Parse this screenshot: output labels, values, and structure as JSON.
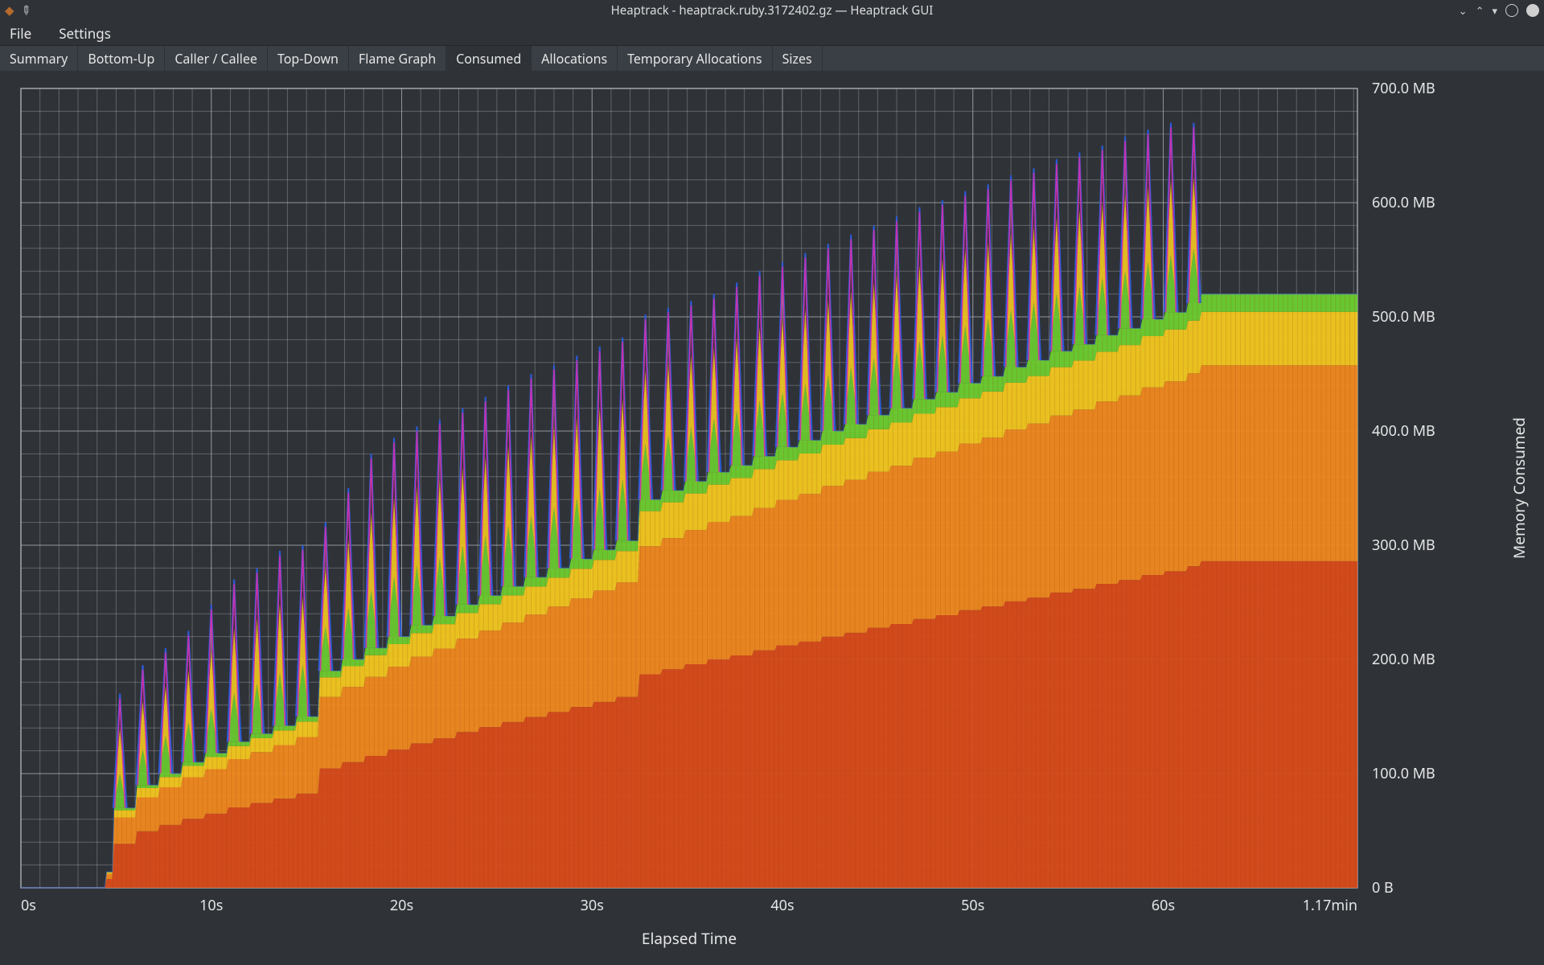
{
  "window": {
    "title": "Heaptrack - heaptrack.ruby.3172402.gz — Heaptrack GUI"
  },
  "menu": {
    "file": "File",
    "settings": "Settings"
  },
  "tabs": [
    {
      "id": "summary",
      "label": "Summary",
      "active": false
    },
    {
      "id": "bottomup",
      "label": "Bottom-Up",
      "active": false
    },
    {
      "id": "callercallee",
      "label": "Caller / Callee",
      "active": false
    },
    {
      "id": "topdown",
      "label": "Top-Down",
      "active": false
    },
    {
      "id": "flame",
      "label": "Flame Graph",
      "active": false
    },
    {
      "id": "consumed",
      "label": "Consumed",
      "active": true
    },
    {
      "id": "allocations",
      "label": "Allocations",
      "active": false
    },
    {
      "id": "tempalloc",
      "label": "Temporary Allocations",
      "active": false
    },
    {
      "id": "sizes",
      "label": "Sizes",
      "active": false
    }
  ],
  "chart_data": {
    "type": "area",
    "title": "",
    "xlabel": "Elapsed Time",
    "ylabel": "Memory Consumed",
    "xlim_seconds": [
      0,
      70.2
    ],
    "ylim_mb": [
      0,
      700
    ],
    "x_tick_labels": [
      "0s",
      "10s",
      "20s",
      "30s",
      "40s",
      "50s",
      "60s",
      "1.17min"
    ],
    "x_tick_positions_s": [
      0,
      10,
      20,
      30,
      40,
      50,
      60,
      70.2
    ],
    "y_tick_labels": [
      "0 B",
      "100.0 MB",
      "200.0 MB",
      "300.0 MB",
      "400.0 MB",
      "500.0 MB",
      "600.0 MB",
      "700.0 MB"
    ],
    "y_tick_positions_mb": [
      0,
      100,
      200,
      300,
      400,
      500,
      600,
      700
    ],
    "x_minor_step_s": 1,
    "y_minor_step_mb": 20,
    "plateau_start_s": 62,
    "plateau_end_s": 70.2,
    "spikes": [
      {
        "t": 5.2,
        "base": 70,
        "peak": 170
      },
      {
        "t": 6.4,
        "base": 90,
        "peak": 195
      },
      {
        "t": 7.6,
        "base": 100,
        "peak": 210
      },
      {
        "t": 8.8,
        "base": 110,
        "peak": 225
      },
      {
        "t": 10.0,
        "base": 118,
        "peak": 248
      },
      {
        "t": 11.2,
        "base": 128,
        "peak": 270
      },
      {
        "t": 12.4,
        "base": 135,
        "peak": 280
      },
      {
        "t": 13.6,
        "base": 142,
        "peak": 295
      },
      {
        "t": 14.8,
        "base": 150,
        "peak": 300
      },
      {
        "t": 16.0,
        "base": 190,
        "peak": 320
      },
      {
        "t": 17.2,
        "base": 200,
        "peak": 350
      },
      {
        "t": 18.4,
        "base": 210,
        "peak": 380
      },
      {
        "t": 19.6,
        "base": 220,
        "peak": 394
      },
      {
        "t": 20.8,
        "base": 230,
        "peak": 404
      },
      {
        "t": 22.0,
        "base": 238,
        "peak": 410
      },
      {
        "t": 23.2,
        "base": 248,
        "peak": 420
      },
      {
        "t": 24.4,
        "base": 256,
        "peak": 430
      },
      {
        "t": 25.6,
        "base": 264,
        "peak": 440
      },
      {
        "t": 26.8,
        "base": 272,
        "peak": 450
      },
      {
        "t": 28.0,
        "base": 280,
        "peak": 458
      },
      {
        "t": 29.2,
        "base": 288,
        "peak": 466
      },
      {
        "t": 30.4,
        "base": 296,
        "peak": 474
      },
      {
        "t": 31.6,
        "base": 304,
        "peak": 482
      },
      {
        "t": 32.8,
        "base": 340,
        "peak": 502
      },
      {
        "t": 34.0,
        "base": 348,
        "peak": 508
      },
      {
        "t": 35.2,
        "base": 356,
        "peak": 514
      },
      {
        "t": 36.4,
        "base": 364,
        "peak": 520
      },
      {
        "t": 37.6,
        "base": 370,
        "peak": 530
      },
      {
        "t": 38.8,
        "base": 378,
        "peak": 540
      },
      {
        "t": 40.0,
        "base": 386,
        "peak": 548
      },
      {
        "t": 41.2,
        "base": 392,
        "peak": 556
      },
      {
        "t": 42.4,
        "base": 400,
        "peak": 564
      },
      {
        "t": 43.6,
        "base": 406,
        "peak": 572
      },
      {
        "t": 44.8,
        "base": 414,
        "peak": 580
      },
      {
        "t": 46.0,
        "base": 420,
        "peak": 588
      },
      {
        "t": 47.2,
        "base": 428,
        "peak": 596
      },
      {
        "t": 48.4,
        "base": 434,
        "peak": 602
      },
      {
        "t": 49.6,
        "base": 442,
        "peak": 610
      },
      {
        "t": 50.8,
        "base": 448,
        "peak": 616
      },
      {
        "t": 52.0,
        "base": 456,
        "peak": 624
      },
      {
        "t": 53.2,
        "base": 462,
        "peak": 630
      },
      {
        "t": 54.4,
        "base": 470,
        "peak": 638
      },
      {
        "t": 55.6,
        "base": 476,
        "peak": 644
      },
      {
        "t": 56.8,
        "base": 484,
        "peak": 650
      },
      {
        "t": 58.0,
        "base": 490,
        "peak": 658
      },
      {
        "t": 59.2,
        "base": 498,
        "peak": 664
      },
      {
        "t": 60.4,
        "base": 504,
        "peak": 670
      },
      {
        "t": 61.6,
        "base": 512,
        "peak": 670
      }
    ],
    "stack_fractions_of_base": {
      "dark_red": 0.55,
      "orange": 0.33,
      "yellow": 0.09,
      "green": 0.03
    },
    "plateau_base_mb": 520,
    "colors": {
      "dark_red": "#d94c1a",
      "orange": "#f08a1f",
      "yellow": "#f2c81f",
      "green": "#6bcf2f",
      "peak_blue": "#2b5bd8",
      "peak_magenta": "#d62ea8"
    }
  }
}
